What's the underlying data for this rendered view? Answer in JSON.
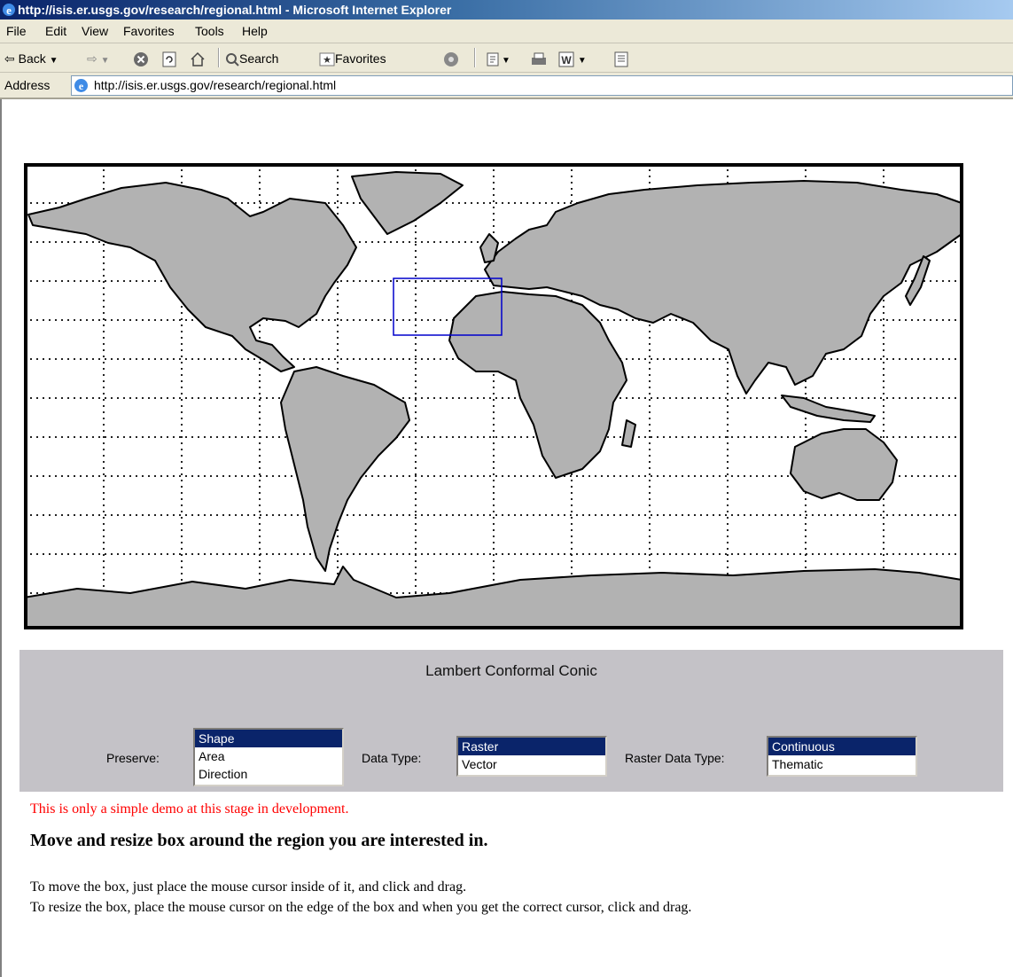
{
  "window": {
    "title": "http://isis.er.usgs.gov/research/regional.html - Microsoft Internet Explorer"
  },
  "menu": [
    "File",
    "Edit",
    "View",
    "Favorites",
    "Tools",
    "Help"
  ],
  "toolbar": {
    "back": "Back",
    "search": "Search",
    "favorites": "Favorites"
  },
  "address": {
    "label": "Address",
    "url": "http://isis.er.usgs.gov/research/regional.html"
  },
  "map": {
    "type": "world map with dotted graticule",
    "land_color": "#b2b2b2",
    "selection_box_color": "#0000cc"
  },
  "panel": {
    "projection": "Lambert Conformal Conic",
    "preserve_label": "Preserve:",
    "preserve_options": [
      "Shape",
      "Area",
      "Direction"
    ],
    "preserve_selected": "Shape",
    "data_type_label": "Data Type:",
    "data_type_options": [
      "Raster",
      "Vector"
    ],
    "data_type_selected": "Raster",
    "raster_type_label": "Raster Data Type:",
    "raster_type_options": [
      "Continuous",
      "Thematic"
    ],
    "raster_type_selected": "Continuous"
  },
  "demo_note": "This is only a simple demo at this stage in development.",
  "heading": "Move and resize box around the region you are interested in.",
  "instructions": [
    "To move the box, just place the mouse cursor inside of it, and click and drag.",
    "To resize the box, place the mouse cursor on the edge of the box and when you get the correct cursor, click and drag."
  ]
}
